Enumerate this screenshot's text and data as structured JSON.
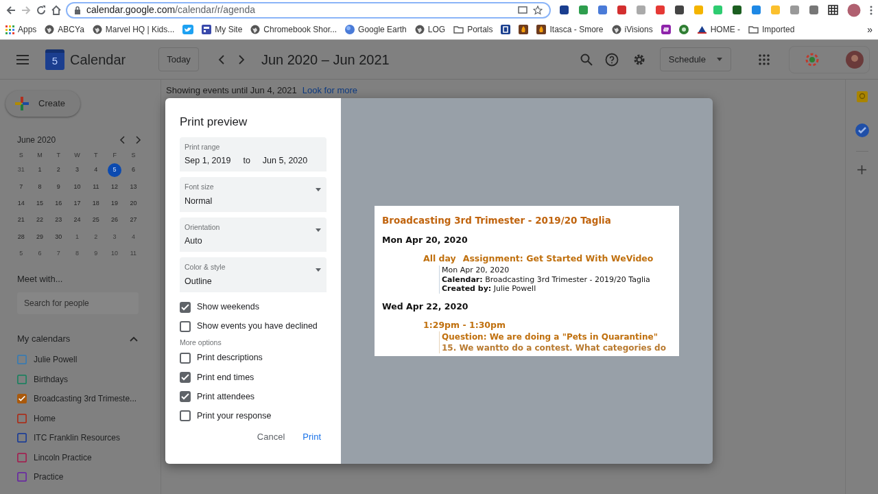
{
  "browser": {
    "url_host": "calendar.google.com",
    "url_path": "/calendar/r/agenda"
  },
  "bookmarks": [
    {
      "label": "Apps",
      "kind": "apps"
    },
    {
      "label": "ABCYa",
      "kind": "globe"
    },
    {
      "label": "Marvel HQ | Kids...",
      "kind": "globe"
    },
    {
      "kind": "bird"
    },
    {
      "label": "My Site",
      "kind": "site"
    },
    {
      "label": "Chromebook Shor...",
      "kind": "globe"
    },
    {
      "label": "Google Earth",
      "kind": "earth"
    },
    {
      "label": "LOG",
      "kind": "globe"
    },
    {
      "label": "Portals",
      "kind": "folder"
    },
    {
      "kind": "letter-p"
    },
    {
      "kind": "flame"
    },
    {
      "label": "Itasca - Smore",
      "kind": "flame"
    },
    {
      "label": "iVisions",
      "kind": "globe"
    },
    {
      "kind": "swirl"
    },
    {
      "kind": "badge"
    },
    {
      "label": "HOME -",
      "kind": "triangle"
    },
    {
      "label": "Imported",
      "kind": "folder"
    }
  ],
  "bookmarks_more": "»",
  "header": {
    "logo_digit": "5",
    "title": "Calendar",
    "today": "Today",
    "range": "Jun 2020 – Jun 2021",
    "view": "Schedule"
  },
  "sidebar": {
    "create": "Create",
    "month": "June 2020",
    "weekdays": [
      "S",
      "M",
      "T",
      "W",
      "T",
      "F",
      "S"
    ],
    "weeks": [
      [
        {
          "day": "31",
          "muted": true,
          "selected": false
        },
        {
          "day": "1",
          "muted": false,
          "selected": false
        },
        {
          "day": "2",
          "muted": false,
          "selected": false
        },
        {
          "day": "3",
          "muted": false,
          "selected": false
        },
        {
          "day": "4",
          "muted": false,
          "selected": false
        },
        {
          "day": "5",
          "muted": false,
          "selected": true
        },
        {
          "day": "6",
          "muted": false,
          "selected": false
        }
      ],
      [
        {
          "day": "7",
          "muted": false,
          "selected": false
        },
        {
          "day": "8",
          "muted": false,
          "selected": false
        },
        {
          "day": "9",
          "muted": false,
          "selected": false
        },
        {
          "day": "10",
          "muted": false,
          "selected": false
        },
        {
          "day": "11",
          "muted": false,
          "selected": false
        },
        {
          "day": "12",
          "muted": false,
          "selected": false
        },
        {
          "day": "13",
          "muted": false,
          "selected": false
        }
      ],
      [
        {
          "day": "14",
          "muted": false,
          "selected": false
        },
        {
          "day": "15",
          "muted": false,
          "selected": false
        },
        {
          "day": "16",
          "muted": false,
          "selected": false
        },
        {
          "day": "17",
          "muted": false,
          "selected": false
        },
        {
          "day": "18",
          "muted": false,
          "selected": false
        },
        {
          "day": "19",
          "muted": false,
          "selected": false
        },
        {
          "day": "20",
          "muted": false,
          "selected": false
        }
      ],
      [
        {
          "day": "21",
          "muted": false,
          "selected": false
        },
        {
          "day": "22",
          "muted": false,
          "selected": false
        },
        {
          "day": "23",
          "muted": false,
          "selected": false
        },
        {
          "day": "24",
          "muted": false,
          "selected": false
        },
        {
          "day": "25",
          "muted": false,
          "selected": false
        },
        {
          "day": "26",
          "muted": false,
          "selected": false
        },
        {
          "day": "27",
          "muted": false,
          "selected": false
        }
      ],
      [
        {
          "day": "28",
          "muted": false,
          "selected": false
        },
        {
          "day": "29",
          "muted": false,
          "selected": false
        },
        {
          "day": "30",
          "muted": false,
          "selected": false
        },
        {
          "day": "1",
          "muted": true,
          "selected": false
        },
        {
          "day": "2",
          "muted": true,
          "selected": false
        },
        {
          "day": "3",
          "muted": true,
          "selected": false
        },
        {
          "day": "4",
          "muted": true,
          "selected": false
        }
      ],
      [
        {
          "day": "5",
          "muted": true,
          "selected": false
        },
        {
          "day": "6",
          "muted": true,
          "selected": false
        },
        {
          "day": "7",
          "muted": true,
          "selected": false
        },
        {
          "day": "8",
          "muted": true,
          "selected": false
        },
        {
          "day": "9",
          "muted": true,
          "selected": false
        },
        {
          "day": "10",
          "muted": true,
          "selected": false
        },
        {
          "day": "11",
          "muted": true,
          "selected": false
        }
      ]
    ],
    "meet_title": "Meet with...",
    "people_search": {
      "placeholder": "Search for people"
    },
    "calendars_title": "My calendars",
    "expanded": true,
    "calendars": [
      {
        "name": "Julie Powell",
        "color": "#3a7bb0",
        "checked": false
      },
      {
        "name": "Birthdays",
        "color": "#1f8060",
        "checked": false
      },
      {
        "name": "Broadcasting 3rd Trimeste...",
        "color": "#a9590c",
        "checked": true
      },
      {
        "name": "Home",
        "color": "#a8301c",
        "checked": false
      },
      {
        "name": "ITC Franklin Resources",
        "color": "#1f3f95",
        "checked": false
      },
      {
        "name": "Lincoln Practice",
        "color": "#a02452",
        "checked": false
      },
      {
        "name": "Practice",
        "color": "#6a2ca0",
        "checked": false
      }
    ]
  },
  "notice": {
    "text": "Showing events until Jun 4, 2021",
    "link": "Look for more"
  },
  "dialog": {
    "title": "Print preview",
    "print_range": {
      "label": "Print range",
      "from": "Sep 1, 2019",
      "joiner": "to",
      "to": "Jun 5, 2020"
    },
    "selects": [
      {
        "label": "Font size",
        "value": "Normal"
      },
      {
        "label": "Orientation",
        "value": "Auto"
      },
      {
        "label": "Color & style",
        "value": "Outline"
      }
    ],
    "options": [
      {
        "label": "Show weekends",
        "checked": true
      },
      {
        "label": "Show events you have declined",
        "checked": false
      }
    ],
    "more_options_label": "More options",
    "more_options": [
      {
        "label": "Print descriptions",
        "checked": false
      },
      {
        "label": "Print end times",
        "checked": true
      },
      {
        "label": "Print attendees",
        "checked": true
      },
      {
        "label": "Print your response",
        "checked": false
      }
    ],
    "cancel": "Cancel",
    "print": "Print"
  },
  "preview": {
    "title": "Broadcasting 3rd Trimester - 2019/20 Taglia",
    "days": [
      {
        "date": "Mon Apr 20, 2020",
        "events": [
          {
            "time": "All day",
            "title": "Assignment: Get Started With WeVideo",
            "lines": [
              "Mon Apr 20, 2020",
              "**Calendar:** Broadcasting 3rd Trimester - 2019/20 Taglia",
              "**Created by:** Julie Powell"
            ]
          }
        ]
      },
      {
        "date": "Wed Apr 22, 2020",
        "events": [
          {
            "time": "1:29pm - 1:30pm",
            "description": [
              "Question: We are doing a \"Pets in Quarantine\"",
              "15. We wantto do a contest. What categories do"
            ]
          }
        ]
      }
    ]
  }
}
